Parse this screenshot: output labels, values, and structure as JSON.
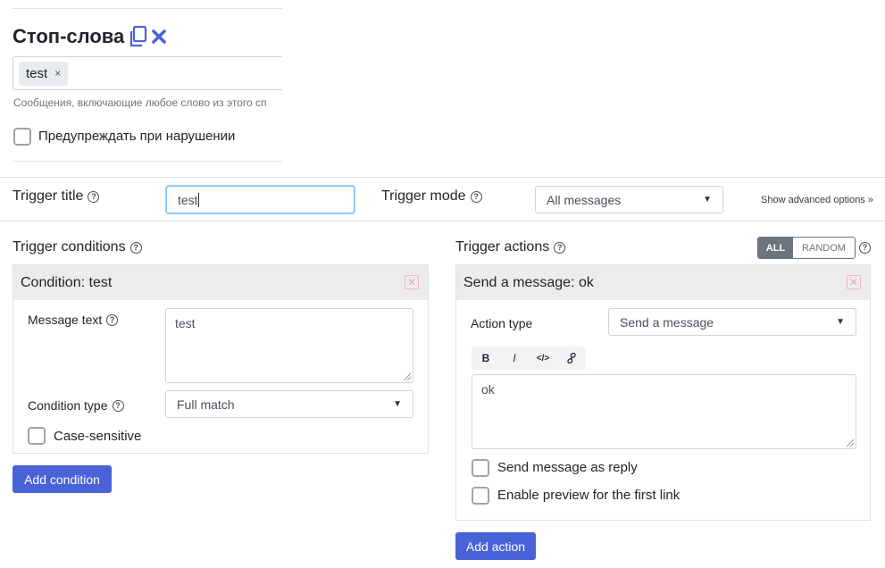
{
  "stopwords": {
    "title": "Стоп-слова",
    "copy_icon": "copy-icon",
    "close_icon": "close-icon",
    "tags": [
      {
        "label": "test",
        "remove": "×"
      }
    ],
    "hint": "Сообщения, включающие любое слово из этого сп",
    "warn_label": "Предупреждать при нарушении"
  },
  "trigger": {
    "title_label": "Trigger title",
    "title_value": "test",
    "mode_label": "Trigger mode",
    "mode_value": "All messages",
    "advanced_link": "Show advanced options »"
  },
  "conditions": {
    "header": "Trigger conditions",
    "card_title": "Condition: test",
    "message_text_label": "Message text",
    "message_text_value": "test",
    "condition_type_label": "Condition type",
    "condition_type_value": "Full match",
    "case_sensitive_label": "Case-sensitive",
    "add_button": "Add condition"
  },
  "actions": {
    "header": "Trigger actions",
    "toggle_all": "ALL",
    "toggle_random": "RANDOM",
    "card_title": "Send a message: ok",
    "action_type_label": "Action type",
    "action_type_value": "Send a message",
    "toolbar": {
      "bold": "B",
      "italic": "I",
      "code": "</>",
      "link_icon": "link-icon"
    },
    "message_value": "ok",
    "reply_label": "Send message as reply",
    "preview_label": "Enable preview for the first link",
    "add_button": "Add action"
  },
  "colors": {
    "primary": "#4a62d8",
    "accent_icon": "#4a62d8",
    "delete": "#f3a5ad"
  }
}
